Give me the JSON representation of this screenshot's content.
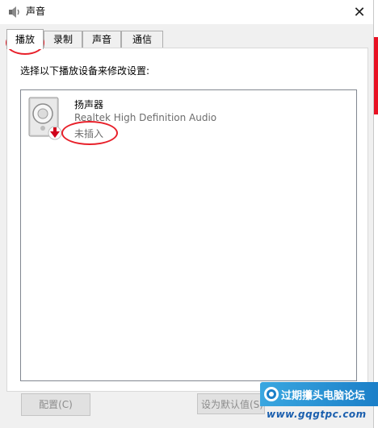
{
  "window": {
    "title": "声音",
    "close_symbol": "✕"
  },
  "tabs": [
    {
      "label": "播放",
      "active": true
    },
    {
      "label": "录制",
      "active": false
    },
    {
      "label": "声音",
      "active": false
    },
    {
      "label": "通信",
      "active": false
    }
  ],
  "instruction": "选择以下播放设备来修改设置:",
  "devices": [
    {
      "name": "扬声器",
      "driver": "Realtek High Definition Audio",
      "status": "未插入",
      "icon": "speaker-icon",
      "status_badge": "unplugged-arrow-icon"
    }
  ],
  "buttons": {
    "configure": "配置(C)",
    "set_default": "设为默认值(S)"
  },
  "watermark": {
    "text": "过期攥头电脑论坛",
    "url": "www.gqgtpc.com"
  },
  "colors": {
    "annotation": "#e8202a",
    "watermark_bg": "#2a90d4",
    "close_accent": "#e81123"
  }
}
